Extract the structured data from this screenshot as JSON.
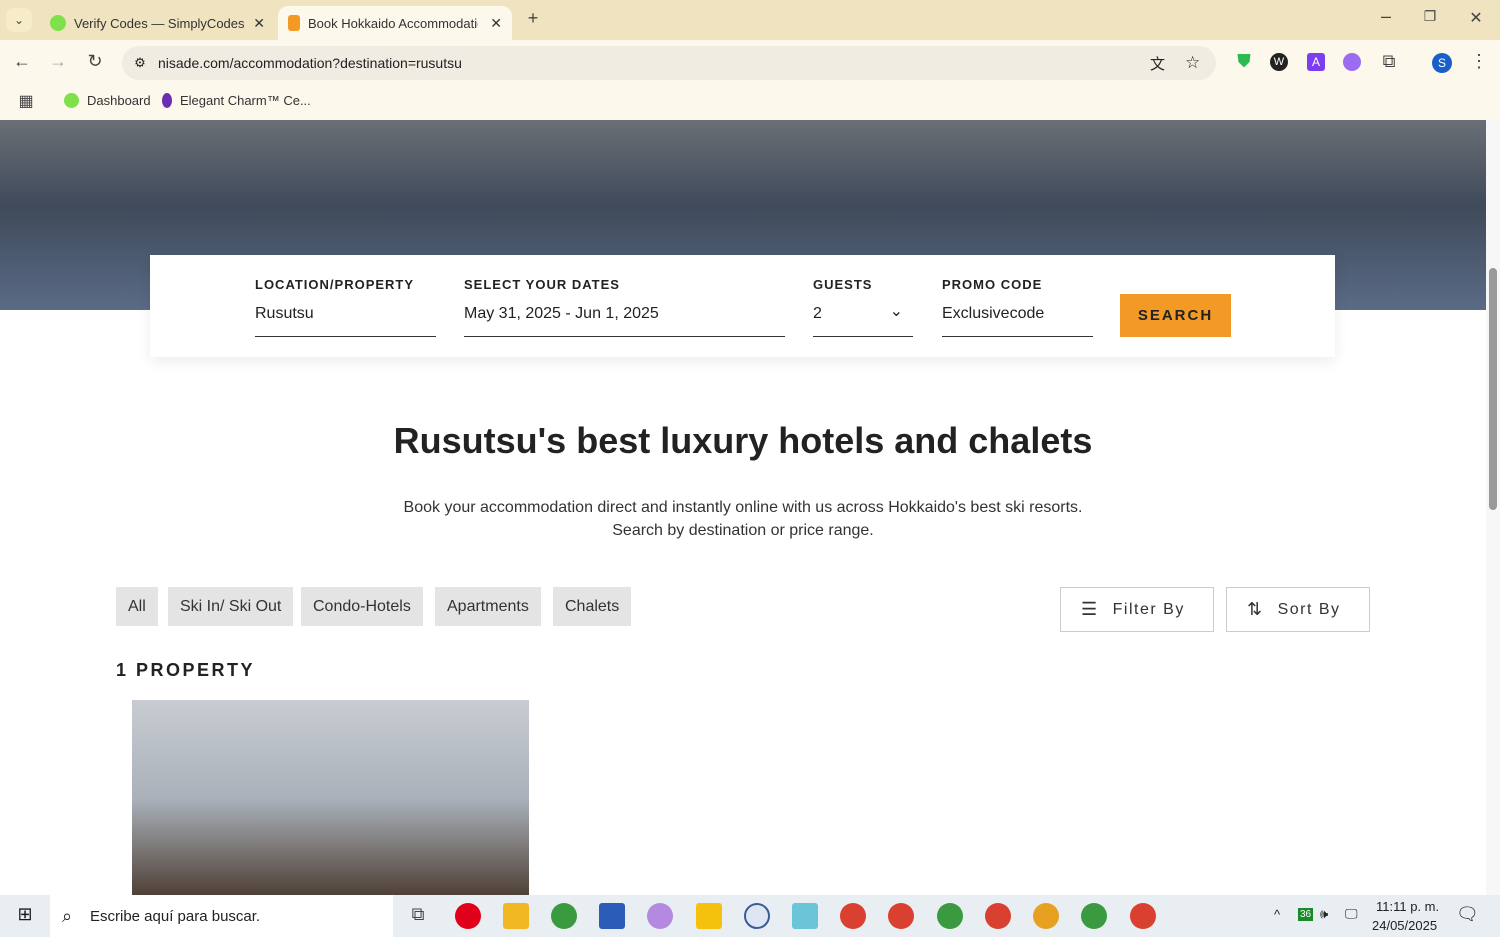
{
  "browser": {
    "tabs": [
      {
        "title": "Verify Codes — SimplyCodes"
      },
      {
        "title": "Book Hokkaido Accommodatio"
      }
    ],
    "url": "nisade.com/accommodation?destination=rusutsu",
    "bookmarks": [
      "Dashboard",
      "Elegant Charm™ Ce..."
    ],
    "profile_initial": "S"
  },
  "search": {
    "location_label": "LOCATION/PROPERTY",
    "location_value": "Rusutsu",
    "dates_label": "SELECT YOUR DATES",
    "dates_value": "May 31, 2025 - Jun 1, 2025",
    "guests_label": "GUESTS",
    "guests_value": "2",
    "promo_label": "PROMO CODE",
    "promo_value": "Exclusivecode",
    "search_button": "SEARCH"
  },
  "main": {
    "title": "Rusutsu's best luxury hotels and chalets",
    "subtitle_1": "Book your accommodation direct and instantly online with us across Hokkaido's best ski resorts.",
    "subtitle_2": "Search by destination or price range.",
    "filters": [
      "All",
      "Ski In/ Ski Out",
      "Condo-Hotels",
      "Apartments",
      "Chalets"
    ],
    "filter_by": "Filter By",
    "sort_by": "Sort By",
    "count": "1 PROPERTY"
  },
  "taskbar": {
    "search_placeholder": "Escribe aquí para buscar.",
    "time": "11:11 p. m.",
    "date": "24/05/2025",
    "badge": "36"
  },
  "colors": {
    "accent": "#f39a26"
  }
}
